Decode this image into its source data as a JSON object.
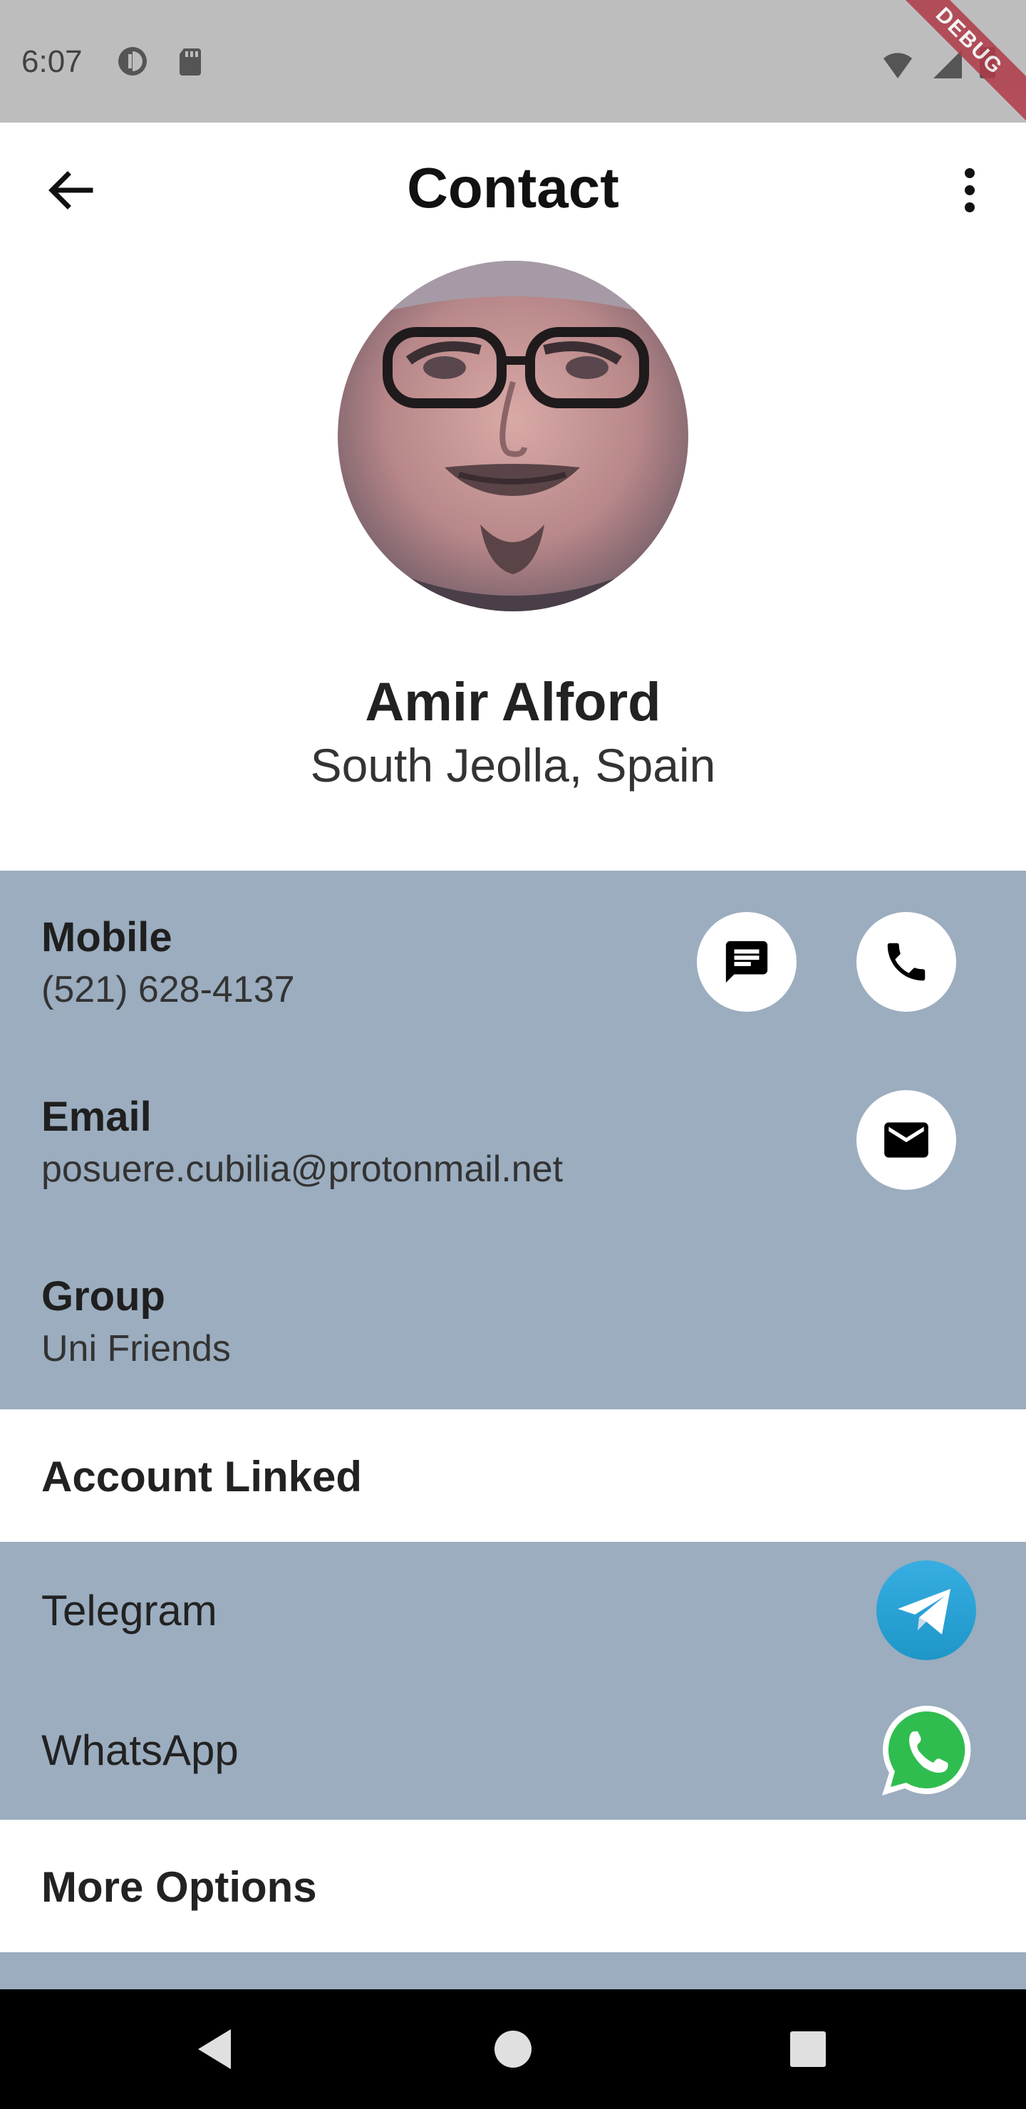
{
  "status_bar": {
    "time": "6:07",
    "debug_label": "DEBUG"
  },
  "app_bar": {
    "title": "Contact"
  },
  "profile": {
    "name": "Amir Alford",
    "location": "South Jeolla, Spain"
  },
  "details": {
    "mobile_label": "Mobile",
    "mobile_value": "(521) 628-4137",
    "email_label": "Email",
    "email_value": "posuere.cubilia@protonmail.net",
    "group_label": "Group",
    "group_value": "Uni Friends"
  },
  "accounts": {
    "header": "Account Linked",
    "items": [
      {
        "label": "Telegram",
        "icon": "telegram-icon",
        "color": "#2aa3e6"
      },
      {
        "label": "WhatsApp",
        "icon": "whatsapp-icon",
        "color": "#2fbd4f"
      }
    ]
  },
  "more_options": {
    "header": "More Options"
  },
  "colors": {
    "section_bg": "#9badbf",
    "status_bar": "#bdbdbd",
    "debug_banner": "#b03a48"
  }
}
